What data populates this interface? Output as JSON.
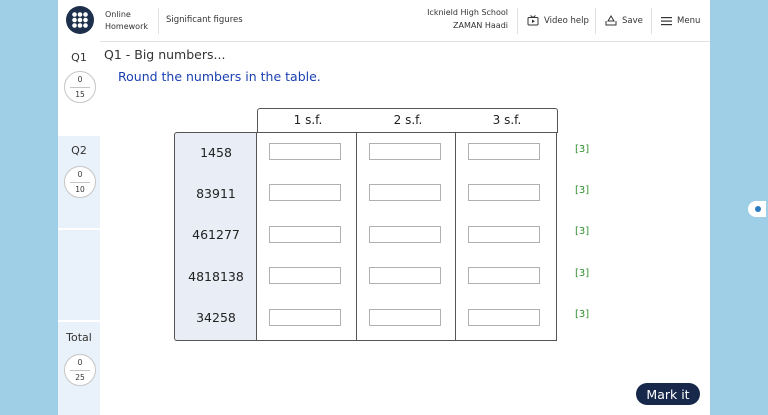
{
  "header": {
    "brand_line1": "Online",
    "brand_line2": "Homework",
    "topic": "Significant figures",
    "school": "Icknield High School",
    "student": "ZAMAN Haadi",
    "video_help": "Video help",
    "save": "Save",
    "menu": "Menu"
  },
  "questions": [
    {
      "label": "Q1",
      "score": "0",
      "total": "15"
    },
    {
      "label": "Q2",
      "score": "0",
      "total": "10"
    }
  ],
  "total": {
    "label": "Total",
    "score": "0",
    "total": "25"
  },
  "main": {
    "title": "Q1 - Big numbers...",
    "instruction": "Round the numbers in the table."
  },
  "table": {
    "headers": [
      "1 s.f.",
      "2 s.f.",
      "3 s.f."
    ],
    "rows": [
      {
        "number": "1458",
        "marks": "[3]",
        "answers": [
          "",
          "",
          ""
        ]
      },
      {
        "number": "83911",
        "marks": "[3]",
        "answers": [
          "",
          "",
          ""
        ]
      },
      {
        "number": "461277",
        "marks": "[3]",
        "answers": [
          "",
          "",
          ""
        ]
      },
      {
        "number": "4818138",
        "marks": "[3]",
        "answers": [
          "",
          "",
          ""
        ]
      },
      {
        "number": "34258",
        "marks": "[3]",
        "answers": [
          "",
          "",
          ""
        ]
      }
    ]
  },
  "mark_button": "Mark it",
  "colors": {
    "accent": "#1a3fb0",
    "marks": "#2f8f2f",
    "button": "#17284a",
    "frame": "#9fcfe6"
  },
  "icons": {
    "logo": "dots-grid-icon",
    "video": "video-icon",
    "save": "save-icon",
    "menu": "hamburger-icon"
  }
}
